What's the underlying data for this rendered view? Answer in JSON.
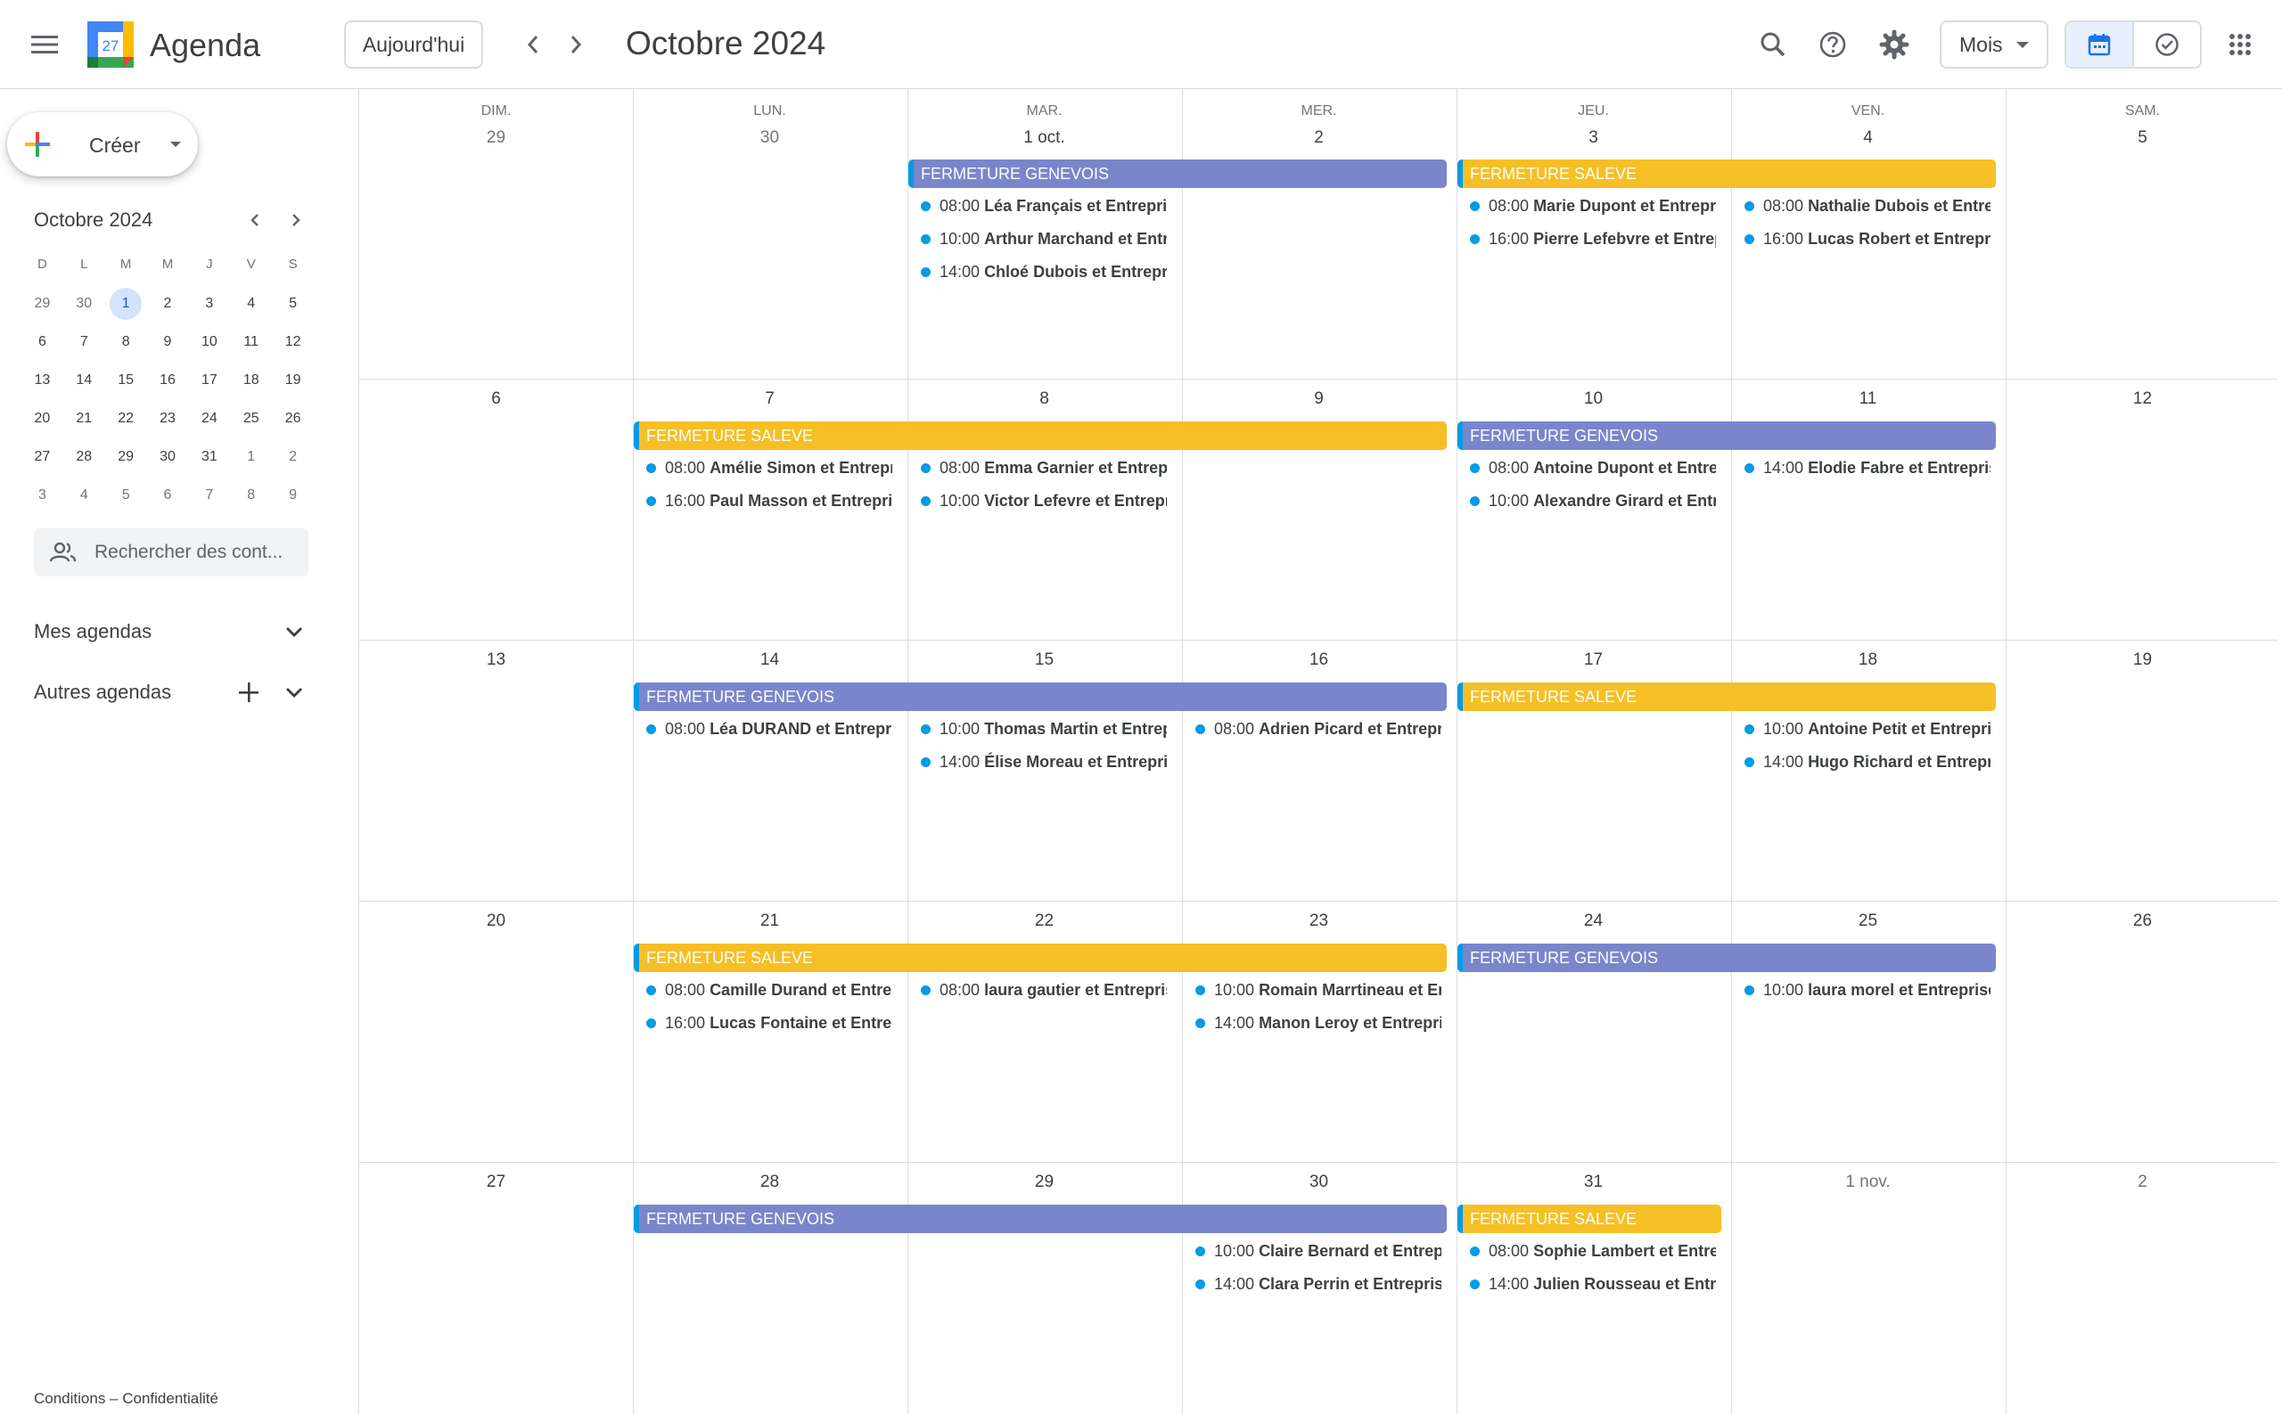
{
  "header": {
    "app_title": "Agenda",
    "logo_day": "27",
    "today_label": "Aujourd'hui",
    "month_title": "Octobre 2024",
    "view_select": "Mois"
  },
  "sidebar": {
    "create_label": "Créer",
    "mini_calendar": {
      "title": "Octobre 2024",
      "weekday_heads": [
        "D",
        "L",
        "M",
        "M",
        "J",
        "V",
        "S"
      ],
      "weeks": [
        [
          "29",
          "30",
          "1",
          "2",
          "3",
          "4",
          "5"
        ],
        [
          "6",
          "7",
          "8",
          "9",
          "10",
          "11",
          "12"
        ],
        [
          "13",
          "14",
          "15",
          "16",
          "17",
          "18",
          "19"
        ],
        [
          "20",
          "21",
          "22",
          "23",
          "24",
          "25",
          "26"
        ],
        [
          "27",
          "28",
          "29",
          "30",
          "31",
          "1",
          "2"
        ],
        [
          "3",
          "4",
          "5",
          "6",
          "7",
          "8",
          "9"
        ]
      ]
    },
    "search_people_placeholder": "Rechercher des cont...",
    "my_calendars": "Mes agendas",
    "other_calendars": "Autres agendas",
    "footer": "Conditions – Confidentialité"
  },
  "calendar": {
    "weekdays": [
      "DIM.",
      "LUN.",
      "MAR.",
      "MER.",
      "JEU.",
      "VEN.",
      "SAM."
    ],
    "weeks": [
      [
        "29",
        "30",
        "1 oct.",
        "2",
        "3",
        "4",
        "5"
      ],
      [
        "6",
        "7",
        "8",
        "9",
        "10",
        "11",
        "12"
      ],
      [
        "13",
        "14",
        "15",
        "16",
        "17",
        "18",
        "19"
      ],
      [
        "20",
        "21",
        "22",
        "23",
        "24",
        "25",
        "26"
      ],
      [
        "27",
        "28",
        "29",
        "30",
        "31",
        "1 nov.",
        "2"
      ]
    ],
    "bars": [
      {
        "label": "FERMETURE GENEVOIS",
        "color": "purple"
      },
      {
        "label": "FERMETURE SALEVE",
        "color": "yellow"
      },
      {
        "label": "FERMETURE SALEVE",
        "color": "yellow"
      },
      {
        "label": "FERMETURE GENEVOIS",
        "color": "purple"
      },
      {
        "label": "FERMETURE GENEVOIS",
        "color": "purple"
      },
      {
        "label": "FERMETURE SALEVE",
        "color": "yellow"
      },
      {
        "label": "FERMETURE SALEVE",
        "color": "yellow"
      },
      {
        "label": "FERMETURE GENEVOIS",
        "color": "purple"
      },
      {
        "label": "FERMETURE GENEVOIS",
        "color": "purple"
      },
      {
        "label": "FERMETURE SALEVE",
        "color": "yellow"
      }
    ],
    "events": [
      {
        "time": "08:00",
        "title": "Léa Français et Entreprise"
      },
      {
        "time": "10:00",
        "title": "Arthur Marchand et Entreprise"
      },
      {
        "time": "14:00",
        "title": "Chloé Dubois et Entreprise"
      },
      {
        "time": "08:00",
        "title": "Marie Dupont et Entreprise"
      },
      {
        "time": "16:00",
        "title": "Pierre Lefebvre et Entreprise"
      },
      {
        "time": "08:00",
        "title": "Nathalie Dubois et Entreprise"
      },
      {
        "time": "16:00",
        "title": "Lucas Robert et Entreprise"
      },
      {
        "time": "08:00",
        "title": "Amélie Simon et Entreprise"
      },
      {
        "time": "16:00",
        "title": "Paul Masson et Entreprise"
      },
      {
        "time": "08:00",
        "title": "Emma Garnier et Entreprise"
      },
      {
        "time": "10:00",
        "title": "Victor Lefevre et Entreprise"
      },
      {
        "time": "08:00",
        "title": "Antoine Dupont et Entreprise"
      },
      {
        "time": "10:00",
        "title": "Alexandre Girard et Entreprise"
      },
      {
        "time": "14:00",
        "title": "Elodie Fabre et Entreprise"
      },
      {
        "time": "08:00",
        "title": "Léa DURAND et Entreprise"
      },
      {
        "time": "10:00",
        "title": "Thomas Martin et Entreprise"
      },
      {
        "time": "14:00",
        "title": "Élise Moreau et Entreprise"
      },
      {
        "time": "08:00",
        "title": "Adrien Picard et Entreprise"
      },
      {
        "time": "10:00",
        "title": "Antoine Petit et Entreprise"
      },
      {
        "time": "14:00",
        "title": "Hugo Richard et Entreprise"
      },
      {
        "time": "08:00",
        "title": "Camille Durand et Entreprise"
      },
      {
        "time": "16:00",
        "title": "Lucas Fontaine et Entreprise"
      },
      {
        "time": "08:00",
        "title": "laura gautier et Entreprise"
      },
      {
        "time": "10:00",
        "title": "Romain Marrtineau et Entreprise"
      },
      {
        "time": "14:00",
        "title": "Manon Leroy et Entreprise"
      },
      {
        "time": "10:00",
        "title": "laura morel et Entreprise"
      },
      {
        "time": "10:00",
        "title": "Claire Bernard et Entreprise"
      },
      {
        "time": "14:00",
        "title": "Clara Perrin et Entreprise"
      },
      {
        "time": "08:00",
        "title": "Sophie Lambert et Entreprise"
      },
      {
        "time": "14:00",
        "title": "Julien Rousseau et Entreprise"
      }
    ]
  },
  "colors": {
    "purple": "#7986cb",
    "yellow": "#f6bf26",
    "event_dot": "#039be5",
    "accent_blue": "#1a73e8"
  },
  "icons": [
    "menu-icon",
    "search-icon",
    "help-icon",
    "gear-icon",
    "calendar-icon",
    "tasks-icon",
    "apps-grid-icon",
    "people-icon",
    "chevron-left-icon",
    "chevron-right-icon",
    "chevron-down-icon",
    "plus-icon"
  ]
}
